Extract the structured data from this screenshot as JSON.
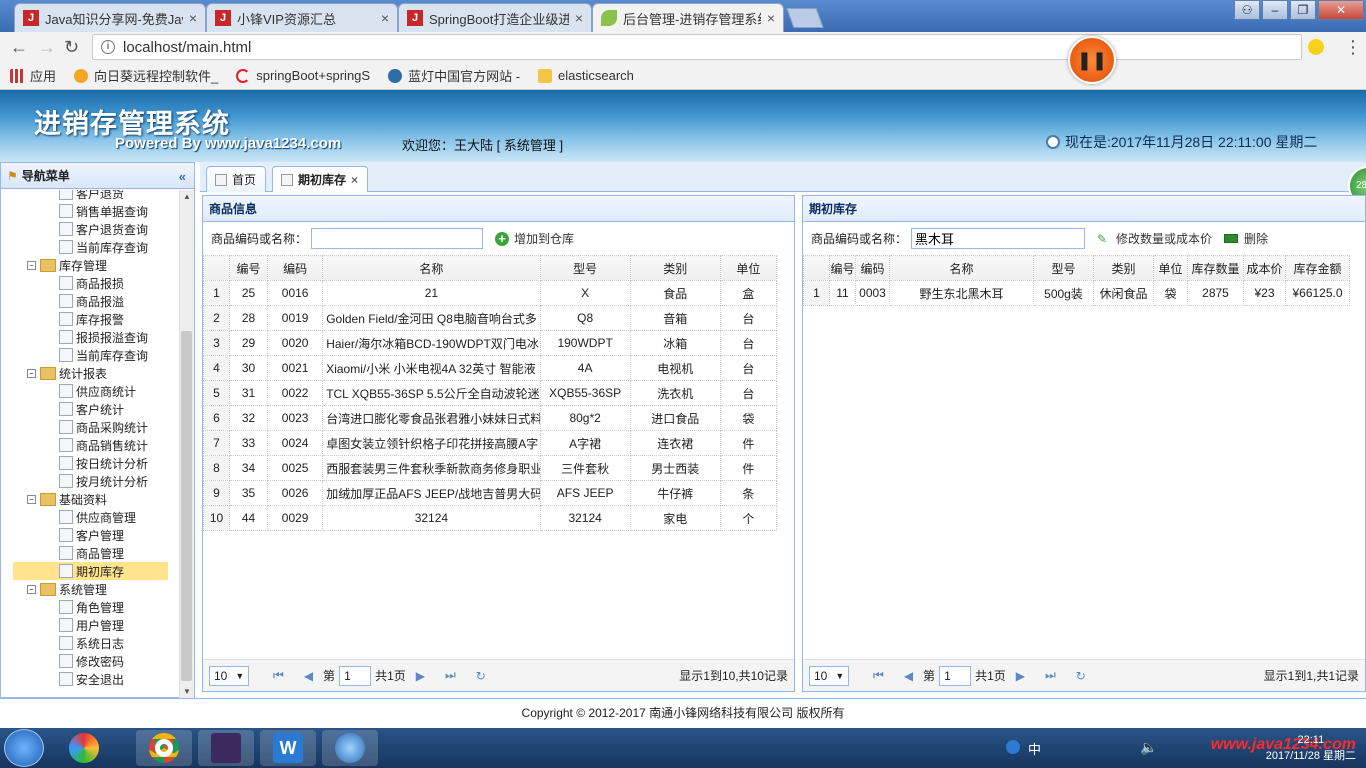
{
  "browser": {
    "tabs": [
      {
        "label": "Java知识分享网-免费Jav",
        "icon": "java1234-icon"
      },
      {
        "label": "小锋VIP资源汇总",
        "icon": "java1234-icon"
      },
      {
        "label": "SpringBoot打造企业级进",
        "icon": "java1234-icon"
      },
      {
        "label": "后台管理-进销存管理系统",
        "icon": "leaf-icon"
      }
    ],
    "close_glyph": "×",
    "url": "localhost/main.html",
    "bookmarks": [
      "应用",
      "向日葵远程控制软件_",
      "springBoot+springS",
      "蓝灯中国官方网站 - ",
      "elasticsearch"
    ]
  },
  "app": {
    "title": "进销存管理系统",
    "powered": "Powered By www.java1234.com",
    "welcome": "欢迎您：王大陆 [ 系统管理 ]",
    "clock": "现在是:2017年11月28日 22:11:00 星期二",
    "footer": "Copyright © 2012-2017 南通小锋网络科技有限公司 版权所有"
  },
  "nav": {
    "title": "导航菜单",
    "collapse_glyph": "«",
    "items": [
      {
        "label": "客户退货",
        "level": 2
      },
      {
        "label": "销售单据查询",
        "level": 2
      },
      {
        "label": "客户退货查询",
        "level": 2
      },
      {
        "label": "当前库存查询",
        "level": 2
      },
      {
        "label": "库存管理",
        "level": 1
      },
      {
        "label": "商品报损",
        "level": 2
      },
      {
        "label": "商品报溢",
        "level": 2
      },
      {
        "label": "库存报警",
        "level": 2
      },
      {
        "label": "报损报溢查询",
        "level": 2
      },
      {
        "label": "当前库存查询",
        "level": 2
      },
      {
        "label": "统计报表",
        "level": 1
      },
      {
        "label": "供应商统计",
        "level": 2
      },
      {
        "label": "客户统计",
        "level": 2
      },
      {
        "label": "商品采购统计",
        "level": 2
      },
      {
        "label": "商品销售统计",
        "level": 2
      },
      {
        "label": "按日统计分析",
        "level": 2
      },
      {
        "label": "按月统计分析",
        "level": 2
      },
      {
        "label": "基础资料",
        "level": 1
      },
      {
        "label": "供应商管理",
        "level": 2
      },
      {
        "label": "客户管理",
        "level": 2
      },
      {
        "label": "商品管理",
        "level": 2
      },
      {
        "label": "期初库存",
        "level": 2,
        "selected": true
      },
      {
        "label": "系统管理",
        "level": 1
      },
      {
        "label": "角色管理",
        "level": 2
      },
      {
        "label": "用户管理",
        "level": 2
      },
      {
        "label": "系统日志",
        "level": 2
      },
      {
        "label": "修改密码",
        "level": 2
      },
      {
        "label": "安全退出",
        "level": 2
      }
    ]
  },
  "content_tabs": [
    {
      "label": "首页"
    },
    {
      "label": "期初库存",
      "closable": true
    }
  ],
  "goods_panel": {
    "title": "商品信息",
    "search_label": "商品编码或名称：",
    "search_value": "",
    "add_button": "增加到仓库",
    "columns": [
      "",
      "编号",
      "编码",
      "名称",
      "型号",
      "类别",
      "单位"
    ],
    "rows": [
      [
        "1",
        "25",
        "0016",
        "21",
        "X",
        "食品",
        "盒"
      ],
      [
        "2",
        "28",
        "0019",
        "Golden Field/金河田 Q8电脑音响台式多",
        "Q8",
        "音箱",
        "台"
      ],
      [
        "3",
        "29",
        "0020",
        "Haier/海尔冰箱BCD-190WDPT双门电冰",
        "190WDPT",
        "冰箱",
        "台"
      ],
      [
        "4",
        "30",
        "0021",
        "Xiaomi/小米 小米电视4A 32英寸 智能液",
        "4A",
        "电视机",
        "台"
      ],
      [
        "5",
        "31",
        "0022",
        "TCL XQB55-36SP 5.5公斤全自动波轮迷",
        "XQB55-36SP",
        "洗衣机",
        "台"
      ],
      [
        "6",
        "32",
        "0023",
        "台湾进口膨化零食品张君雅小妹妹日式料",
        "80g*2",
        "进口食品",
        "袋"
      ],
      [
        "7",
        "33",
        "0024",
        "卓图女装立领针织格子印花拼接高腰A字",
        "A字裙",
        "连衣裙",
        "件"
      ],
      [
        "8",
        "34",
        "0025",
        "西服套装男三件套秋季新款商务修身职业",
        "三件套秋",
        "男士西装",
        "件"
      ],
      [
        "9",
        "35",
        "0026",
        "加绒加厚正品AFS JEEP/战地吉普男大码",
        "AFS JEEP",
        "牛仔裤",
        "条"
      ],
      [
        "10",
        "44",
        "0029",
        "32124",
        "32124",
        "家电",
        "个"
      ]
    ],
    "pager": {
      "size": "10",
      "page_prefix": "第",
      "page": "1",
      "page_suffix": "共1页",
      "info": "显示1到10,共10记录"
    }
  },
  "stock_panel": {
    "title": "期初库存",
    "search_label": "商品编码或名称：",
    "search_value": "黑木耳",
    "edit_button": "修改数量或成本价",
    "delete_button": "删除",
    "columns": [
      "",
      "编号",
      "编码",
      "名称",
      "型号",
      "类别",
      "单位",
      "库存数量",
      "成本价",
      "库存金额"
    ],
    "rows": [
      [
        "1",
        "11",
        "0003",
        "野生东北黑木耳",
        "500g装",
        "休闲食品",
        "袋",
        "2875",
        "¥23",
        "¥66125.0"
      ]
    ],
    "pager": {
      "size": "10",
      "page_prefix": "第",
      "page": "1",
      "page_suffix": "共1页",
      "info": "显示1到1,共1记录"
    }
  },
  "taskbar": {
    "time": "22:11",
    "date": "2017/11/28 星期二",
    "ime": "中",
    "watermark": "www.java1234.com",
    "bubble": "28"
  },
  "recorder_glyph": "❚❚"
}
